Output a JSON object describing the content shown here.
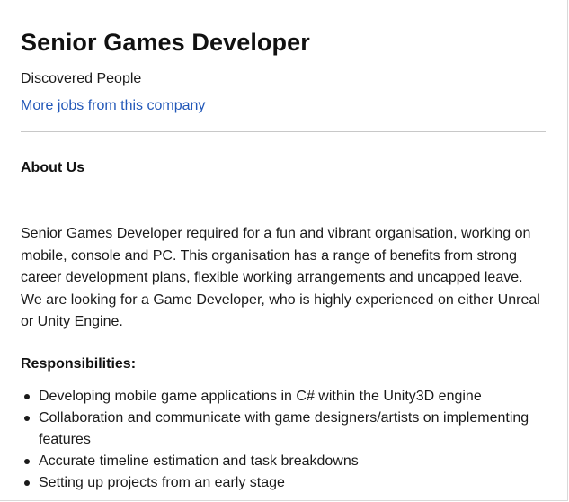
{
  "job": {
    "title": "Senior Games Developer",
    "company": "Discovered People",
    "more_jobs_link": "More jobs from this company"
  },
  "about": {
    "heading": "About Us",
    "paragraph": "Senior Games Developer required for a fun and vibrant organisation, working on mobile, console and PC. This  organisation has a range of benefits from strong career development plans, flexible working arrangements and uncapped leave. We are looking for a Game Developer, who is highly experienced on either Unreal or Unity Engine."
  },
  "responsibilities": {
    "heading": "Responsibilities:",
    "items": [
      "Developing mobile game applications in C# within the Unity3D engine",
      "Collaboration and communicate with game designers/artists on implementing features",
      "Accurate timeline estimation and task breakdowns",
      "Setting up projects from an early stage"
    ]
  }
}
